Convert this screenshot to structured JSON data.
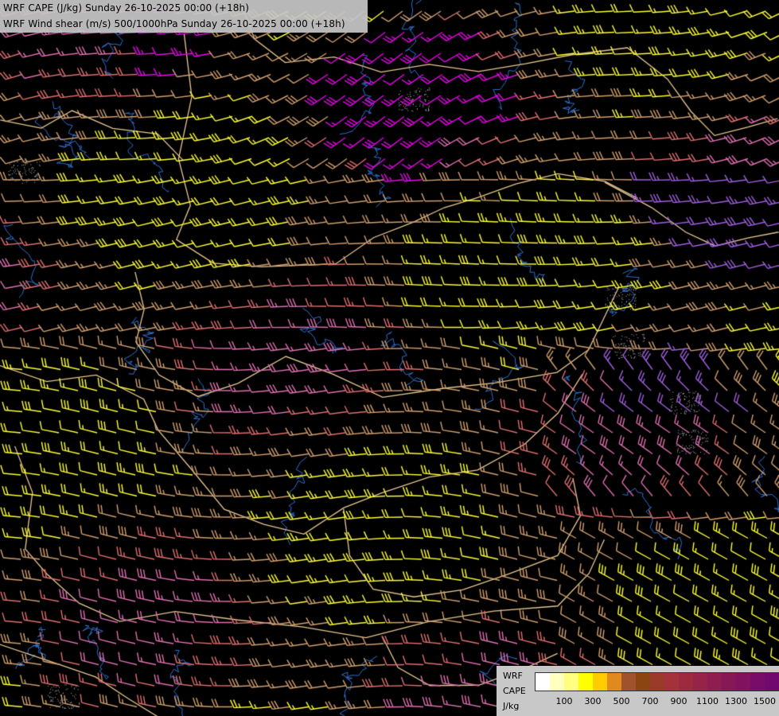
{
  "title": {
    "line1": "WRF CAPE (J/kg) Sunday 26-10-2025 00:00 (+18h)",
    "line2": "WRF Wind shear (m/s) 500/1000hPa Sunday 26-10-2025 00:00 (+18h)"
  },
  "legend": {
    "model": "WRF",
    "field": "CAPE",
    "unit": "J/kg",
    "colors": [
      "#ffffff",
      "#ffffc0",
      "#ffff80",
      "#ffff00",
      "#ffcc00",
      "#e08a1e",
      "#a0522d",
      "#8b4513",
      "#9a3b2a",
      "#a5323a",
      "#9e2a40",
      "#962448",
      "#8e1e50",
      "#871858",
      "#801260",
      "#780c68",
      "#700870",
      "#8a0a7a"
    ],
    "ticks": [
      "100",
      "300",
      "500",
      "700",
      "900",
      "1100",
      "1300",
      "1500"
    ]
  },
  "barb_colors": {
    "low": "#ffff33",
    "tan": "#d2a070",
    "salmon": "#e07070",
    "pink": "#e070b0",
    "magenta": "#ee00ee",
    "violet": "#a060e0"
  },
  "map_colors": {
    "background": "#000000",
    "borders": "#e8c890",
    "rivers": "#3070d0",
    "terrain": "#b0b0b0"
  }
}
